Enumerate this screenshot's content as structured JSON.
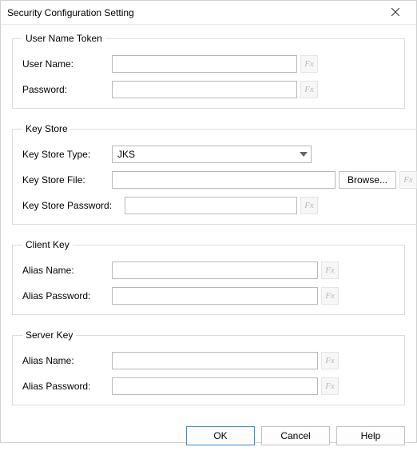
{
  "window": {
    "title": "Security Configuration Setting"
  },
  "groups": {
    "userToken": {
      "legend": "User Name Token",
      "userNameLabel": "User Name:",
      "userNameValue": "",
      "passwordLabel": "Password:",
      "passwordValue": ""
    },
    "keyStore": {
      "legend": "Key Store",
      "typeLabel": "Key Store Type:",
      "typeValue": "JKS",
      "fileLabel": "Key Store File:",
      "fileValue": "",
      "browseLabel": "Browse...",
      "passwordLabel": "Key Store Password:",
      "passwordValue": ""
    },
    "clientKey": {
      "legend": "Client Key",
      "aliasNameLabel": "Alias Name:",
      "aliasNameValue": "",
      "aliasPasswordLabel": "Alias Password:",
      "aliasPasswordValue": ""
    },
    "serverKey": {
      "legend": "Server Key",
      "aliasNameLabel": "Alias Name:",
      "aliasNameValue": "",
      "aliasPasswordLabel": "Alias Password:",
      "aliasPasswordValue": ""
    }
  },
  "fx": "Fx",
  "buttons": {
    "ok": "OK",
    "cancel": "Cancel",
    "help": "Help"
  }
}
